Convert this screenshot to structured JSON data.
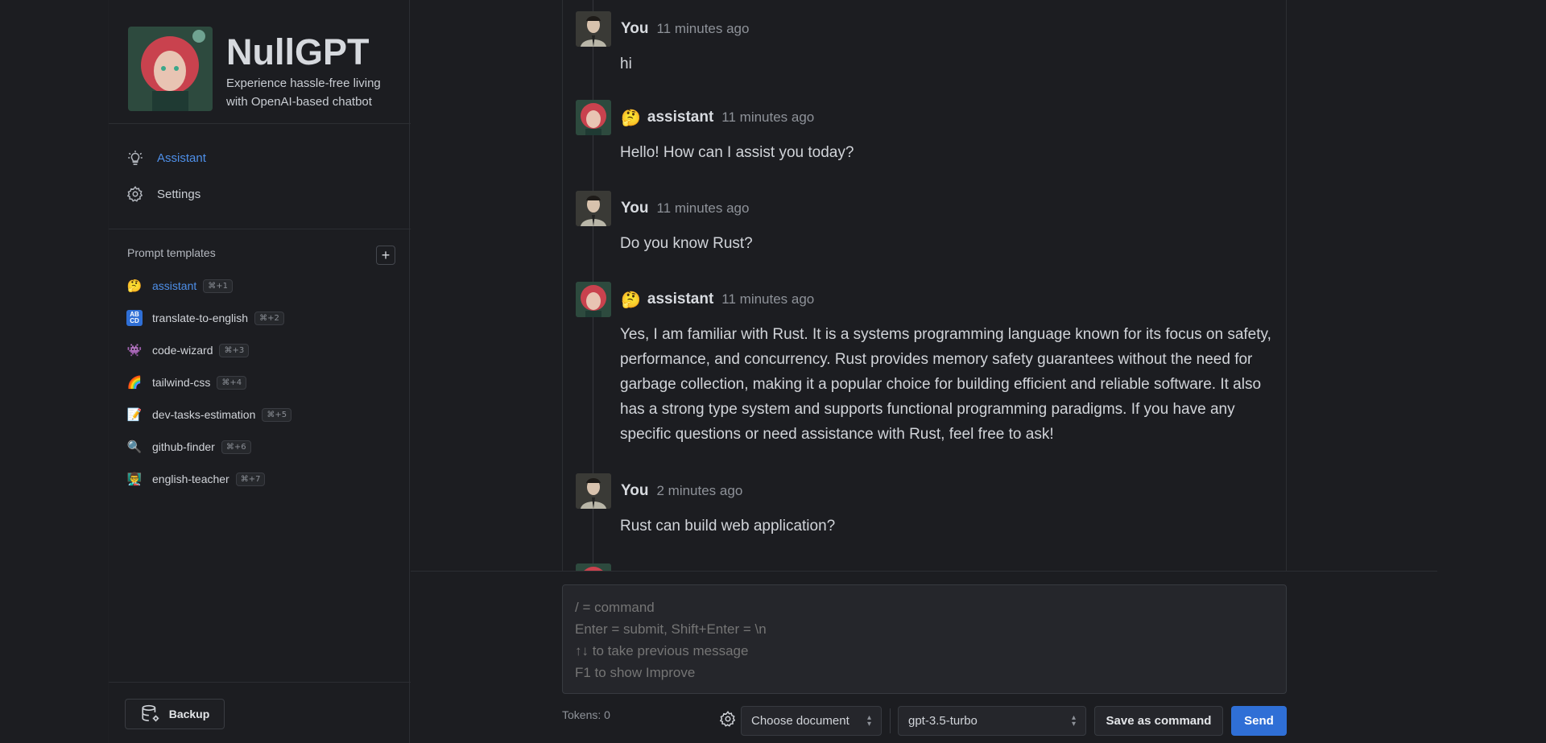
{
  "brand": {
    "title": "NullGPT",
    "subtitle": "Experience hassle-free living with OpenAI-based chatbot"
  },
  "nav": [
    {
      "label": "Assistant",
      "icon": "bulb-icon",
      "active": true
    },
    {
      "label": "Settings",
      "icon": "gear-icon",
      "active": false
    }
  ],
  "prompt_templates": {
    "heading": "Prompt templates",
    "add_icon": "plus-icon",
    "items": [
      {
        "emoji": "🤔",
        "name": "assistant",
        "shortcut": "⌘+1",
        "active": true
      },
      {
        "emoji": "🔤",
        "name": "translate-to-english",
        "shortcut": "⌘+2",
        "active": false
      },
      {
        "emoji": "👾",
        "name": "code-wizard",
        "shortcut": "⌘+3",
        "active": false
      },
      {
        "emoji": "🌈",
        "name": "tailwind-css",
        "shortcut": "⌘+4",
        "active": false
      },
      {
        "emoji": "📝",
        "name": "dev-tasks-estimation",
        "shortcut": "⌘+5",
        "active": false
      },
      {
        "emoji": "🔍",
        "name": "github-finder",
        "shortcut": "⌘+6",
        "active": false
      },
      {
        "emoji": "👨‍🏫",
        "name": "english-teacher",
        "shortcut": "⌘+7",
        "active": false
      }
    ]
  },
  "backup": {
    "label": "Backup",
    "icon": "database-gear-icon"
  },
  "messages": [
    {
      "role": "user",
      "author": "You",
      "emoji": "",
      "time": "11 minutes ago",
      "text": "hi"
    },
    {
      "role": "assistant",
      "author": "assistant",
      "emoji": "🤔",
      "time": "11 minutes ago",
      "text": "Hello! How can I assist you today?"
    },
    {
      "role": "user",
      "author": "You",
      "emoji": "",
      "time": "11 minutes ago",
      "text": "Do you know Rust?"
    },
    {
      "role": "assistant",
      "author": "assistant",
      "emoji": "🤔",
      "time": "11 minutes ago",
      "text": "Yes, I am familiar with Rust. It is a systems programming language known for its focus on safety, performance, and concurrency. Rust provides memory safety guarantees without the need for garbage collection, making it a popular choice for building efficient and reliable software. It also has a strong type system and supports functional programming paradigms. If you have any specific questions or need assistance with Rust, feel free to ask!"
    },
    {
      "role": "user",
      "author": "You",
      "emoji": "",
      "time": "2 minutes ago",
      "text": "Rust can build web application?"
    }
  ],
  "composer": {
    "placeholder": "/ = command\nEnter = submit, Shift+Enter = \\n\n↑↓ to take previous message\nF1 to show Improve",
    "value": ""
  },
  "footer": {
    "tokens": "Tokens: 0",
    "document_select": "Choose document",
    "model_select": "gpt-3.5-turbo",
    "save_as_command": "Save as command",
    "send": "Send"
  },
  "colors": {
    "background": "#1c1d21",
    "accent": "#4e8fe8",
    "send_button": "#2f6fd6"
  }
}
